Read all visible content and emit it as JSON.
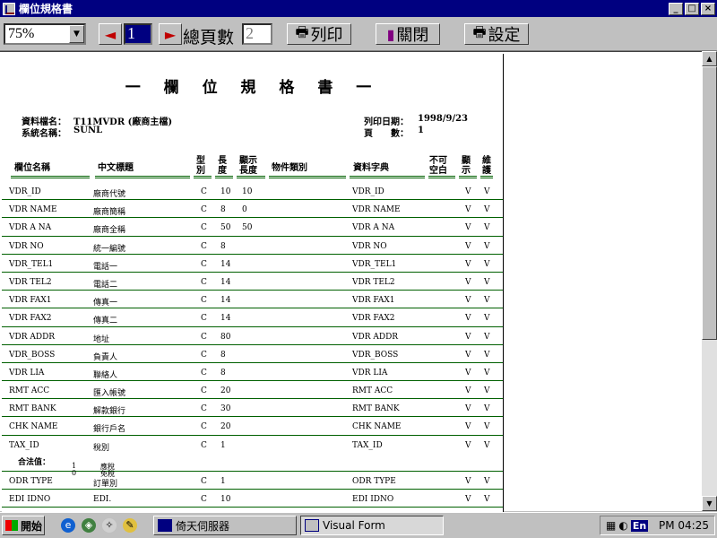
{
  "window": {
    "title": "欄位規格書",
    "minimize": "_",
    "maximize": "□",
    "close": "×"
  },
  "toolbar": {
    "zoom": "75%",
    "prev_arrow": "◄",
    "next_arrow": "►",
    "current_page": "1",
    "total_label": "總頁數",
    "total_pages": "2",
    "print_label": "列印",
    "close_label": "關閉",
    "settings_label": "設定"
  },
  "report": {
    "title": "一 欄 位 規 格 書 一",
    "file_label": "資料檔名：",
    "file_value": "T11MVDR (廠商主檔)",
    "system_label": "系統名稱：",
    "system_value": "SUNL",
    "date_label": "列印日期：",
    "date_value": "1998/9/23",
    "page_label": "頁　　數：",
    "page_value": "1",
    "columns": {
      "field": "欄位名稱",
      "chinese": "中文標題",
      "type": "型別",
      "length": "長度",
      "display_length": "顯示長度",
      "object_type": "物件類別",
      "dictionary": "資料字典",
      "not_null": "不可空白",
      "display": "顯示",
      "maintain": "維護"
    },
    "rows": [
      [
        "VDR_ID",
        "廠商代號",
        "C",
        "10",
        "10",
        "",
        "VDR_ID",
        "",
        "V",
        "V"
      ],
      [
        "VDR NAME",
        "廠商簡稱",
        "C",
        "8",
        "0",
        "",
        "VDR NAME",
        "",
        "V",
        "V"
      ],
      [
        "VDR A NA",
        "廠商全稱",
        "C",
        "50",
        "50",
        "",
        "VDR A NA",
        "",
        "V",
        "V"
      ],
      [
        "VDR NO",
        "統一編號",
        "C",
        "8",
        "",
        "",
        "VDR NO",
        "",
        "V",
        "V"
      ],
      [
        "VDR_TEL1",
        "電話一",
        "C",
        "14",
        "",
        "",
        "VDR_TEL1",
        "",
        "V",
        "V"
      ],
      [
        "VDR TEL2",
        "電話二",
        "C",
        "14",
        "",
        "",
        "VDR TEL2",
        "",
        "V",
        "V"
      ],
      [
        "VDR FAX1",
        "傳真一",
        "C",
        "14",
        "",
        "",
        "VDR FAX1",
        "",
        "V",
        "V"
      ],
      [
        "VDR FAX2",
        "傳真二",
        "C",
        "14",
        "",
        "",
        "VDR FAX2",
        "",
        "V",
        "V"
      ],
      [
        "VDR ADDR",
        "地址",
        "C",
        "80",
        "",
        "",
        "VDR ADDR",
        "",
        "V",
        "V"
      ],
      [
        "VDR_BOSS",
        "負責人",
        "C",
        "8",
        "",
        "",
        "VDR_BOSS",
        "",
        "V",
        "V"
      ],
      [
        "VDR LIA",
        "聯絡人",
        "C",
        "8",
        "",
        "",
        "VDR LIA",
        "",
        "V",
        "V"
      ],
      [
        "RMT ACC",
        "匯入帳號",
        "C",
        "20",
        "",
        "",
        "RMT ACC",
        "",
        "V",
        "V"
      ],
      [
        "RMT BANK",
        "解款銀行",
        "C",
        "30",
        "",
        "",
        "RMT BANK",
        "",
        "V",
        "V"
      ],
      [
        "CHK NAME",
        "銀行戶名",
        "C",
        "20",
        "",
        "",
        "CHK NAME",
        "",
        "V",
        "V"
      ],
      [
        "TAX_ID",
        "稅別",
        "C",
        "1",
        "",
        "",
        "TAX_ID",
        "",
        "V",
        "V"
      ],
      [
        "ODR TYPE",
        "訂單別",
        "C",
        "1",
        "",
        "",
        "ODR TYPE",
        "",
        "V",
        "V"
      ],
      [
        "EDI IDNO",
        "EDI.",
        "C",
        "10",
        "",
        "",
        "EDI IDNO",
        "",
        "V",
        "V"
      ]
    ],
    "code_label": "合法值：",
    "codes": [
      [
        "1",
        "應稅"
      ],
      [
        "0",
        "免稅"
      ]
    ]
  },
  "taskbar": {
    "start": "開始",
    "task1": "倚天伺服器",
    "task2": "Visual Form",
    "lang": "En",
    "clock": "PM 04:25"
  }
}
